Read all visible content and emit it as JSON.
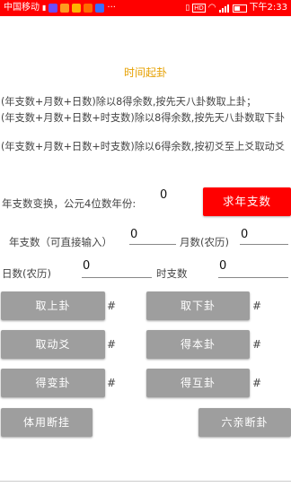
{
  "status_bar": {
    "carrier": "中国移动",
    "icons": [
      "hd-icon",
      "signal-icon",
      "app-icon-1",
      "app-icon-2",
      "app-icon-3",
      "app-icon-4",
      "app-icon-5"
    ],
    "more": "···",
    "right_icons": [
      "vibrate-icon",
      "hd-icon",
      "wifi-icon",
      "signal-icon",
      "battery-icon"
    ],
    "hd_label": "HD",
    "time": "下午2:33",
    "colors": {
      "bar": "#ff0000"
    }
  },
  "header": {
    "title": "时间起卦",
    "title_color": "#e6a000"
  },
  "descriptions": [
    "(年支数+月数+日数)除以8得余数,按先天八卦数取上卦；",
    "(年支数+月数+日数+时支数)除以8得余数,按先天八卦数取下卦",
    "(年支数+月数+日数+时支数)除以6得余数,按初爻至上爻取动爻"
  ],
  "year_convert": {
    "label": "年支数变换，公元4位数年份:",
    "value": "0",
    "button_label": "求年支数",
    "button_color": "#ff0000"
  },
  "inputs": {
    "year_branch_label": "年支数（可直接输入）",
    "year_branch_value": "0",
    "month_label": "月数(农历)",
    "month_value": "0",
    "day_label": "日数(农历)",
    "day_value": "0",
    "hour_label": "时支数",
    "hour_value": "0"
  },
  "actions": {
    "upper_label": "取上卦",
    "upper_result": "#",
    "lower_label": "取下卦",
    "lower_result": "#",
    "moving_label": "取动爻",
    "moving_result": "#",
    "base_label": "得本卦",
    "base_result": "#",
    "changed_label": "得变卦",
    "changed_result": "#",
    "mutual_label": "得互卦",
    "mutual_result": "#",
    "tiyong_label": "体用断挂",
    "liuqin_label": "六亲断卦",
    "button_color": "#9e9e9e"
  }
}
